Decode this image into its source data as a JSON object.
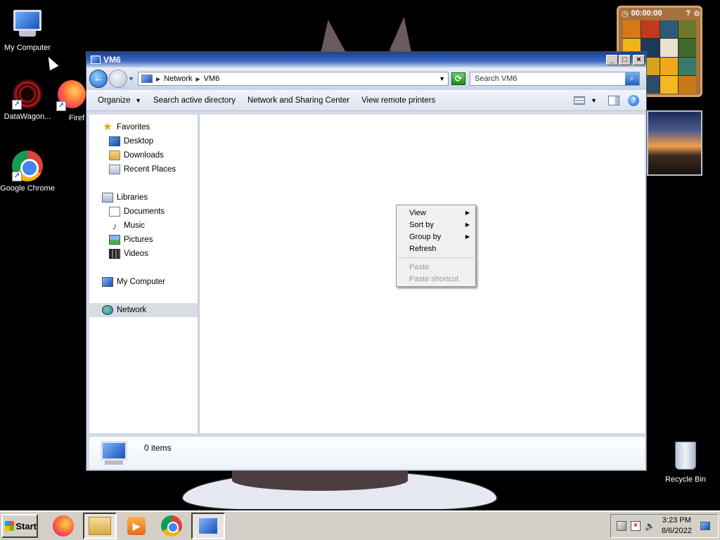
{
  "desktop": {
    "icons": [
      {
        "label": "My Computer"
      },
      {
        "label": "DataWagon..."
      },
      {
        "label": "Firef"
      },
      {
        "label": "Google Chrome"
      },
      {
        "label": "Recycle Bin"
      }
    ],
    "puzzle_gadget": {
      "timer": "00:00:00",
      "help": "?",
      "tiles": [
        "#d4781a",
        "#c23a1e",
        "#2e5a7a",
        "#6a7a2a",
        "#f2b21a",
        "#1e3a5a",
        "#e8e2d0",
        "#3f6a2e",
        "#2a4a6a",
        "#d9a21a",
        "#f0a818",
        "#3a7a6a",
        "#1d3550",
        "#2d4d6d",
        "#f5b81f",
        "#c87a1a"
      ]
    }
  },
  "window": {
    "title": "VM6",
    "address": {
      "segments": [
        "Network",
        "VM6"
      ]
    },
    "search": {
      "placeholder": "Search VM6"
    },
    "toolbar": {
      "buttons": [
        "Organize",
        "Search active directory",
        "Network and Sharing Center",
        "View remote printers"
      ]
    },
    "nav": {
      "favorites": {
        "label": "Favorites",
        "items": [
          "Desktop",
          "Downloads",
          "Recent Places"
        ]
      },
      "libraries": {
        "label": "Libraries",
        "items": [
          "Documents",
          "Music",
          "Pictures",
          "Videos"
        ]
      },
      "computer": {
        "label": "My Computer"
      },
      "network": {
        "label": "Network"
      }
    },
    "details": {
      "count": "0 items"
    }
  },
  "context_menu": {
    "items": [
      {
        "label": "View",
        "submenu": true
      },
      {
        "label": "Sort by",
        "submenu": true
      },
      {
        "label": "Group by",
        "submenu": true
      },
      {
        "label": "Refresh"
      }
    ],
    "disabled_items": [
      "Paste",
      "Paste shortcut"
    ]
  },
  "taskbar": {
    "start_label": "Start",
    "clock": {
      "time": "3:23 PM",
      "date": "8/6/2022"
    }
  }
}
